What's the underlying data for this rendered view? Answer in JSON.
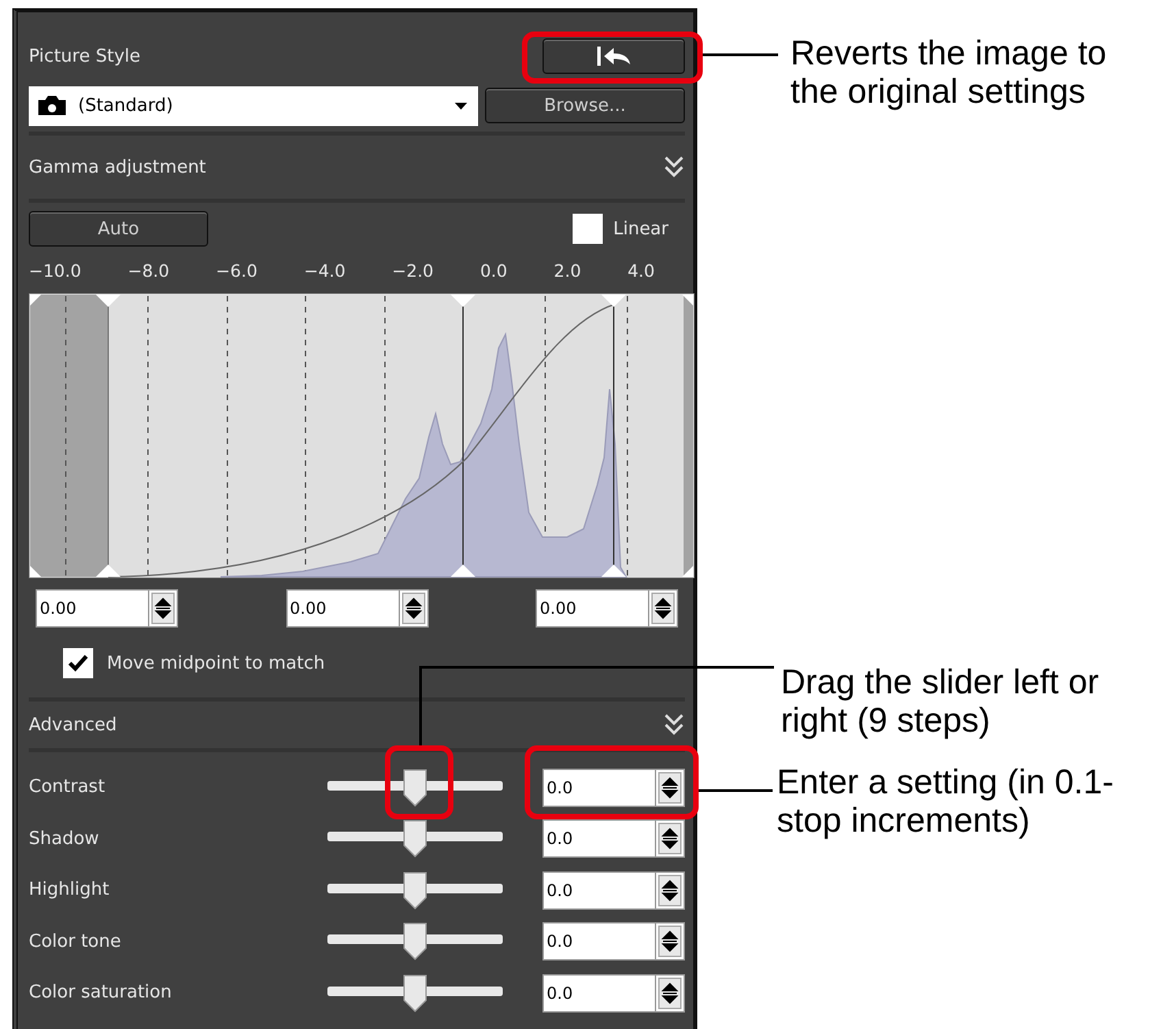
{
  "picture_style": {
    "title": "Picture Style",
    "style_value": "(Standard)",
    "browse_button": "Browse..."
  },
  "gamma": {
    "title": "Gamma adjustment",
    "auto_button": "Auto",
    "linear": {
      "label": "Linear",
      "checked": false
    },
    "scale": [
      "−10.0",
      "−8.0",
      "−6.0",
      "−4.0",
      "−2.0",
      "0.0",
      "2.0",
      "4.0"
    ],
    "points": [
      {
        "value": "0.00"
      },
      {
        "value": "0.00"
      },
      {
        "value": "0.00"
      }
    ],
    "move_midpoint": {
      "label": "Move midpoint to match",
      "checked": true
    }
  },
  "advanced": {
    "title": "Advanced",
    "settings": [
      {
        "name": "Contrast",
        "level": 0.5,
        "value": "0.0"
      },
      {
        "name": "Shadow",
        "level": 0.5,
        "value": "0.0"
      },
      {
        "name": "Highlight",
        "level": 0.5,
        "value": "0.0"
      },
      {
        "name": "Color tone",
        "level": 0.5,
        "value": "0.0"
      },
      {
        "name": "Color saturation",
        "level": 0.5,
        "value": "0.0"
      }
    ]
  },
  "callouts": [
    {
      "text": "Reverts the image to the original settings"
    },
    {
      "text": "Drag the slider left or right (9 steps)"
    },
    {
      "text": "Enter a setting (in 0.1-stop increments)"
    }
  ]
}
